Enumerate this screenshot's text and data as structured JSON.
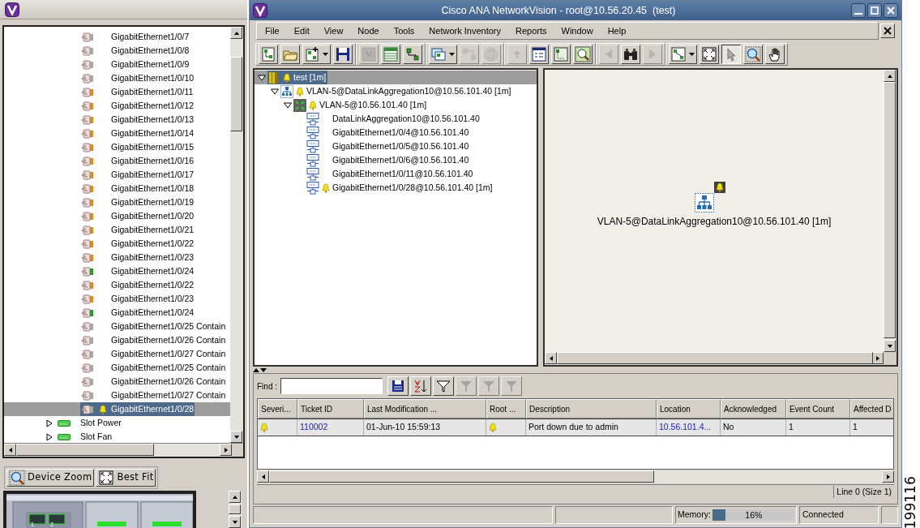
{
  "left_window": {
    "device_tree": [
      {
        "kind": "port",
        "label": "GigabitEthernet1/0/7",
        "color": "#a8a8a8",
        "alarm": false,
        "selected": false
      },
      {
        "kind": "port",
        "label": "GigabitEthernet1/0/8",
        "color": "#a8a8a8",
        "alarm": false,
        "selected": false
      },
      {
        "kind": "port",
        "label": "GigabitEthernet1/0/9",
        "color": "#a8a8a8",
        "alarm": false,
        "selected": false
      },
      {
        "kind": "port",
        "label": "GigabitEthernet1/0/10",
        "color": "#a8a8a8",
        "alarm": false,
        "selected": false
      },
      {
        "kind": "port",
        "label": "GigabitEthernet1/0/11",
        "color": "#e08a1e",
        "alarm": false,
        "selected": false
      },
      {
        "kind": "port",
        "label": "GigabitEthernet1/0/12",
        "color": "#e08a1e",
        "alarm": false,
        "selected": false
      },
      {
        "kind": "port",
        "label": "GigabitEthernet1/0/13",
        "color": "#e08a1e",
        "alarm": false,
        "selected": false
      },
      {
        "kind": "port",
        "label": "GigabitEthernet1/0/14",
        "color": "#e08a1e",
        "alarm": false,
        "selected": false
      },
      {
        "kind": "port",
        "label": "GigabitEthernet1/0/15",
        "color": "#e08a1e",
        "alarm": false,
        "selected": false
      },
      {
        "kind": "port",
        "label": "GigabitEthernet1/0/16",
        "color": "#e08a1e",
        "alarm": false,
        "selected": false
      },
      {
        "kind": "port",
        "label": "GigabitEthernet1/0/17",
        "color": "#e08a1e",
        "alarm": false,
        "selected": false
      },
      {
        "kind": "port",
        "label": "GigabitEthernet1/0/18",
        "color": "#e08a1e",
        "alarm": false,
        "selected": false
      },
      {
        "kind": "port",
        "label": "GigabitEthernet1/0/19",
        "color": "#e08a1e",
        "alarm": false,
        "selected": false
      },
      {
        "kind": "port",
        "label": "GigabitEthernet1/0/20",
        "color": "#e08a1e",
        "alarm": false,
        "selected": false
      },
      {
        "kind": "port",
        "label": "GigabitEthernet1/0/21",
        "color": "#e08a1e",
        "alarm": false,
        "selected": false
      },
      {
        "kind": "port",
        "label": "GigabitEthernet1/0/22",
        "color": "#e08a1e",
        "alarm": false,
        "selected": false
      },
      {
        "kind": "port",
        "label": "GigabitEthernet1/0/23",
        "color": "#e08a1e",
        "alarm": false,
        "selected": false
      },
      {
        "kind": "port",
        "label": "GigabitEthernet1/0/24",
        "color": "#22a02a",
        "alarm": false,
        "selected": false
      },
      {
        "kind": "port",
        "label": "GigabitEthernet1/0/22",
        "color": "#e08a1e",
        "alarm": false,
        "selected": false
      },
      {
        "kind": "port",
        "label": "GigabitEthernet1/0/23",
        "color": "#e08a1e",
        "alarm": false,
        "selected": false
      },
      {
        "kind": "port",
        "label": "GigabitEthernet1/0/24",
        "color": "#22a02a",
        "alarm": false,
        "selected": false
      },
      {
        "kind": "port",
        "label": "GigabitEthernet1/0/25 Contain",
        "color": "#a8a8a8",
        "alarm": false,
        "selected": false
      },
      {
        "kind": "port",
        "label": "GigabitEthernet1/0/26 Contain",
        "color": "#a8a8a8",
        "alarm": false,
        "selected": false
      },
      {
        "kind": "port",
        "label": "GigabitEthernet1/0/27 Contain",
        "color": "#a8a8a8",
        "alarm": false,
        "selected": false
      },
      {
        "kind": "port",
        "label": "GigabitEthernet1/0/25 Contain",
        "color": "#a8a8a8",
        "alarm": false,
        "selected": false
      },
      {
        "kind": "port",
        "label": "GigabitEthernet1/0/26 Contain",
        "color": "#a8a8a8",
        "alarm": false,
        "selected": false
      },
      {
        "kind": "port",
        "label": "GigabitEthernet1/0/27 Contain",
        "color": "#a8a8a8",
        "alarm": false,
        "selected": false
      },
      {
        "kind": "port",
        "label": "GigabitEthernet1/0/28",
        "color": "#a8a8a8",
        "alarm": true,
        "selected": true
      },
      {
        "kind": "slot",
        "label": "Slot Power",
        "expanded": false,
        "selected": false
      },
      {
        "kind": "slot",
        "label": "Slot Fan",
        "expanded": false,
        "selected": false
      }
    ],
    "buttons": [
      {
        "kind": "zoom",
        "label": "Device Zoom"
      },
      {
        "kind": "fit",
        "label": "Best Fit"
      }
    ],
    "device_view": {
      "port_labels": [
        "1",
        "2"
      ]
    }
  },
  "window": {
    "title": "Cisco ANA NetworkVision - root@10.56.20.45  (test)"
  },
  "menu": [
    "File",
    "Edit",
    "View",
    "Node",
    "Tools",
    "Network Inventory",
    "Reports",
    "Window",
    "Help"
  ],
  "toolbar_groups": [
    [
      {
        "kind": "new-map",
        "disabled": false,
        "dropdown": false,
        "pressed": false
      },
      {
        "kind": "folder",
        "disabled": false,
        "dropdown": false,
        "pressed": false
      },
      {
        "kind": "add-node",
        "disabled": false,
        "dropdown": true,
        "pressed": false
      },
      {
        "kind": "save",
        "disabled": false,
        "dropdown": false,
        "pressed": false
      }
    ],
    [
      {
        "kind": "topology",
        "disabled": true,
        "dropdown": false,
        "pressed": false
      },
      {
        "kind": "table",
        "disabled": false,
        "dropdown": false,
        "pressed": false
      },
      {
        "kind": "link",
        "disabled": false,
        "dropdown": false,
        "pressed": false
      }
    ],
    [
      {
        "kind": "overlay",
        "disabled": false,
        "dropdown": true,
        "pressed": false
      },
      {
        "kind": "aggregate",
        "disabled": true,
        "dropdown": false,
        "pressed": false
      },
      {
        "kind": "refresh",
        "disabled": true,
        "dropdown": false,
        "pressed": false
      }
    ],
    [
      {
        "kind": "up",
        "disabled": true,
        "dropdown": false,
        "pressed": false
      },
      {
        "kind": "properties",
        "disabled": false,
        "dropdown": false,
        "pressed": false
      },
      {
        "kind": "map-report",
        "disabled": false,
        "dropdown": false,
        "pressed": false
      },
      {
        "kind": "money",
        "disabled": false,
        "dropdown": false,
        "pressed": false
      }
    ],
    [
      {
        "kind": "back",
        "disabled": true,
        "dropdown": false,
        "pressed": false
      },
      {
        "kind": "binoculars",
        "disabled": false,
        "dropdown": false,
        "pressed": false
      },
      {
        "kind": "forward",
        "disabled": true,
        "dropdown": false,
        "pressed": false
      }
    ],
    [
      {
        "kind": "layout",
        "disabled": false,
        "dropdown": true,
        "pressed": false
      },
      {
        "kind": "fit",
        "disabled": false,
        "dropdown": false,
        "pressed": false
      },
      {
        "kind": "select",
        "disabled": false,
        "dropdown": false,
        "pressed": true
      },
      {
        "kind": "zoom",
        "disabled": false,
        "dropdown": false,
        "pressed": false
      },
      {
        "kind": "pan",
        "disabled": false,
        "dropdown": false,
        "pressed": false
      }
    ]
  ],
  "topology_tree": [
    {
      "label": "test [1m]",
      "kind": "map",
      "alarm": true,
      "expanded": true,
      "selected": true,
      "children": [
        {
          "label": "VLAN-5@DataLinkAggregation10@10.56.101.40 [1m]",
          "kind": "network",
          "alarm": true,
          "expanded": true,
          "selected": false,
          "children": [
            {
              "label": "VLAN-5@10.56.101.40 [1m]",
              "kind": "vlan",
              "alarm": true,
              "expanded": true,
              "selected": false,
              "children": [
                {
                  "label": "DataLinkAggregation10@10.56.101.40",
                  "kind": "port",
                  "alarm": false,
                  "selected": false
                },
                {
                  "label": "GigabitEthernet1/0/4@10.56.101.40",
                  "kind": "port",
                  "alarm": false,
                  "selected": false
                },
                {
                  "label": "GigabitEthernet1/0/5@10.56.101.40",
                  "kind": "port",
                  "alarm": false,
                  "selected": false
                },
                {
                  "label": "GigabitEthernet1/0/6@10.56.101.40",
                  "kind": "port",
                  "alarm": false,
                  "selected": false
                },
                {
                  "label": "GigabitEthernet1/0/11@10.56.101.40",
                  "kind": "port",
                  "alarm": false,
                  "selected": false
                },
                {
                  "label": "GigabitEthernet1/0/28@10.56.101.40 [1m]",
                  "kind": "port",
                  "alarm": true,
                  "selected": false
                }
              ]
            }
          ]
        }
      ]
    }
  ],
  "map": {
    "node": {
      "label": "VLAN-5@DataLinkAggregation10@10.56.101.40 [1m]",
      "alarm": true
    }
  },
  "tickets": {
    "find_label": "Find :",
    "columns": [
      "Severi...",
      "Ticket ID",
      "Last Modification ...",
      "Root ...",
      "Description",
      "Location",
      "Acknowledged",
      "Event Count",
      "Affected D"
    ],
    "rows": [
      {
        "severity_alarm": true,
        "ticket_id": "110002",
        "last_modification": "01-Jun-10 15:59:13",
        "root_alarm": true,
        "description": "Port down due to admin",
        "location": "10.56.101.4...",
        "acknowledged": "No",
        "event_count": "1",
        "affected": "1"
      }
    ],
    "line_status": "Line 0 (Size 1)"
  },
  "status_bar": {
    "memory": {
      "label": "Memory:",
      "level": 0.16,
      "reading": "16%"
    },
    "connection": "Connected"
  },
  "figure_number": "199116"
}
